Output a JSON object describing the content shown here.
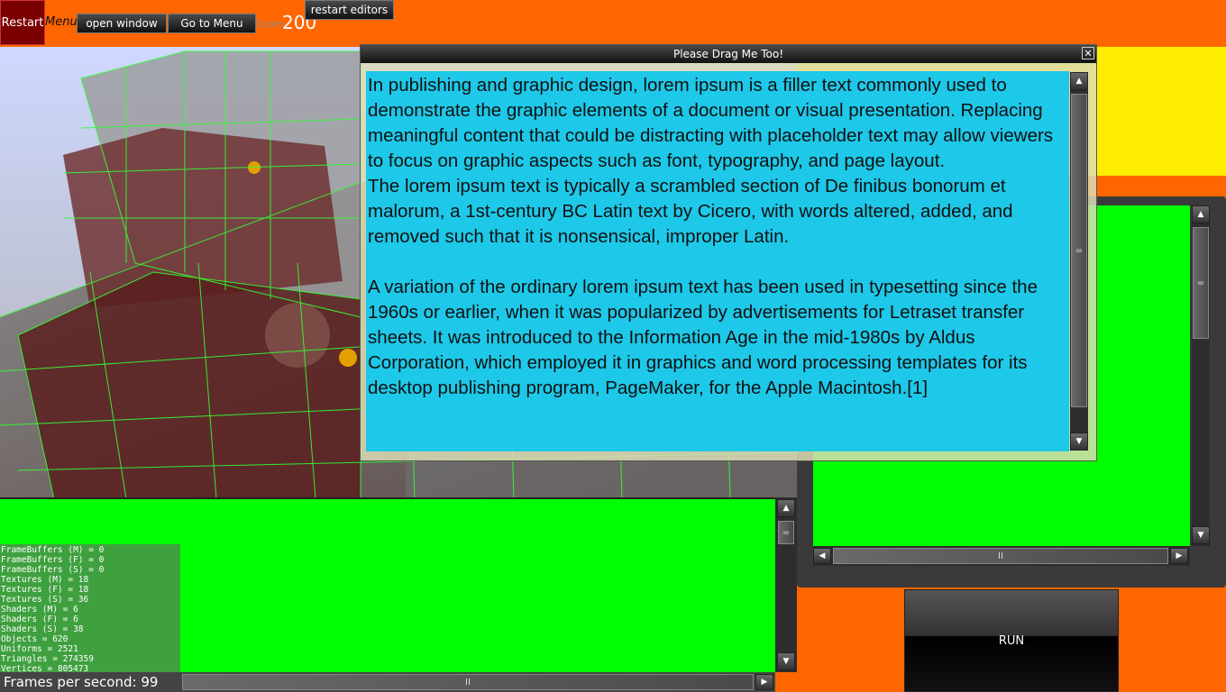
{
  "topbar": {
    "restart_label": "Restart",
    "menu_label": "Menu",
    "open_window_label": "open window",
    "go_to_menu_label": "Go to Menu",
    "score_label": "Score",
    "score_value": "200",
    "restart_editors_label": "restart editors"
  },
  "dialog": {
    "title": "Please Drag Me Too!",
    "close_glyph": "✕",
    "paragraphs": [
      "In publishing and graphic design, lorem ipsum is a filler text commonly used to demonstrate the graphic elements of a document or visual presentation. Replacing meaningful content that could be distracting with placeholder text may allow viewers to focus on graphic aspects such as font, typography, and page layout.",
      "The lorem ipsum text is typically a scrambled section of De finibus bonorum et malorum, a 1st-century BC Latin text by Cicero, with words altered, added, and removed such that it is nonsensical, improper Latin.",
      "A variation of the ordinary lorem ipsum text has been used in typesetting since the 1960s or earlier, when it was popularized by advertisements for Letraset transfer sheets. It was introduced to the Information Age in the mid-1980s by Aldus Corporation, which employed it in graphics and word processing templates for its desktop publishing program, PageMaker, for the Apple Macintosh.[1]"
    ]
  },
  "run_button": {
    "label": "RUN"
  },
  "stats": {
    "lines": [
      "FrameBuffers (M) = 0",
      "FrameBuffers (F) = 0",
      "FrameBuffers (S) = 0",
      "Textures (M) = 18",
      "Textures (F) = 18",
      "Textures (S) = 36",
      "Shaders (M) = 6",
      "Shaders (F) = 6",
      "Shaders (S) = 38",
      "Objects = 620",
      "Uniforms = 2521",
      "Triangles = 274359",
      "Vertices = 805473"
    ],
    "fps_label": "Frames per second: 99"
  },
  "scrollbars": {
    "up_glyph": "▲",
    "down_glyph": "▼",
    "left_glyph": "◀",
    "right_glyph": "▶",
    "v_thumb_glyph": "=",
    "h_thumb_glyph": "II"
  }
}
